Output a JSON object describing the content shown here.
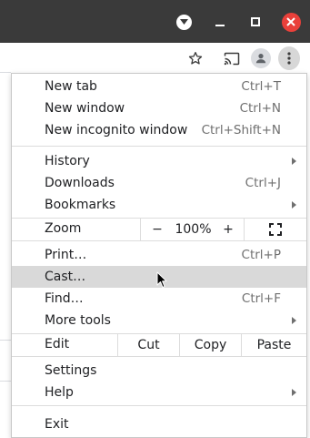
{
  "window": {
    "icons": [
      "tab-search-icon",
      "minimize-icon",
      "maximize-icon",
      "close-icon"
    ]
  },
  "toolbar": {
    "icons": [
      "star-icon",
      "cast-icon",
      "profile-icon",
      "kebab-menu-icon"
    ]
  },
  "menu": {
    "new_tab": {
      "label": "New tab",
      "accel": "Ctrl+T"
    },
    "new_window": {
      "label": "New window",
      "accel": "Ctrl+N"
    },
    "new_incognito": {
      "label": "New incognito window",
      "accel": "Ctrl+Shift+N"
    },
    "history": {
      "label": "History"
    },
    "downloads": {
      "label": "Downloads",
      "accel": "Ctrl+J"
    },
    "bookmarks": {
      "label": "Bookmarks"
    },
    "zoom": {
      "label": "Zoom",
      "minus": "−",
      "level": "100%",
      "plus": "+"
    },
    "print": {
      "label": "Print…",
      "accel": "Ctrl+P"
    },
    "cast": {
      "label": "Cast…"
    },
    "find": {
      "label": "Find…",
      "accel": "Ctrl+F"
    },
    "more_tools": {
      "label": "More tools"
    },
    "edit": {
      "label": "Edit",
      "cut": "Cut",
      "copy": "Copy",
      "paste": "Paste"
    },
    "settings": {
      "label": "Settings"
    },
    "help": {
      "label": "Help"
    },
    "exit": {
      "label": "Exit"
    }
  },
  "colors": {
    "titlebar": "#3a3a3a",
    "close": "#e9403a",
    "highlight": "#d9d9d9"
  }
}
